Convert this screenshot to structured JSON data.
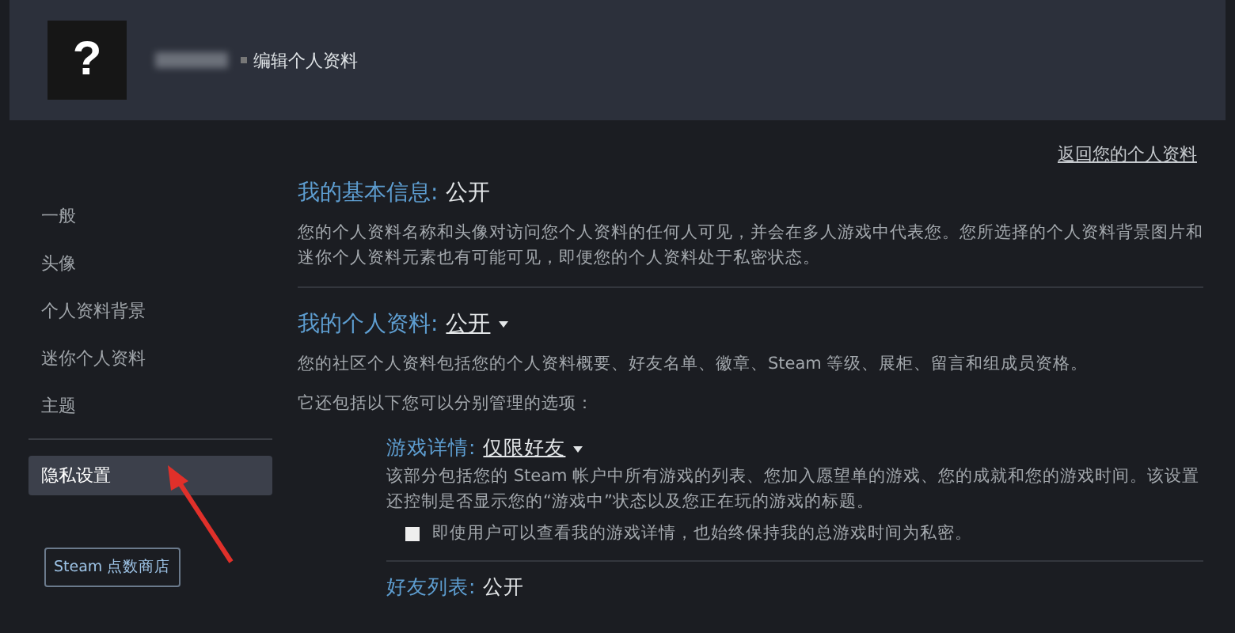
{
  "header": {
    "avatar_glyph": "?",
    "title": "编辑个人资料"
  },
  "sidebar": {
    "groups": [
      [
        {
          "label": "一般",
          "selected": false
        },
        {
          "label": "头像",
          "selected": false
        },
        {
          "label": "个人资料背景",
          "selected": false
        },
        {
          "label": "迷你个人资料",
          "selected": false
        },
        {
          "label": "主题",
          "selected": false
        }
      ],
      [
        {
          "label": "隐私设置",
          "selected": true
        }
      ]
    ],
    "store_button": "Steam 点数商店"
  },
  "back_link": "返回您的个人资料",
  "sections": [
    {
      "label": "我的基本信息:",
      "value": "公开",
      "dropdown": false,
      "paragraphs": [
        "您的个人资料名称和头像对访问您个人资料的任何人可见，并会在多人游戏中代表您。您所选择的个人资料背景图片和迷你个人资料元素也有可能可见，即便您的个人资料处于私密状态。"
      ]
    },
    {
      "label": "我的个人资料:",
      "value": "公开",
      "dropdown": true,
      "paragraphs": [
        "您的社区个人资料包括您的个人资料概要、好友名单、徽章、Steam 等级、展柜、留言和组成员资格。",
        "它还包括以下您可以分别管理的选项："
      ],
      "subsections": [
        {
          "label": "游戏详情:",
          "value": "仅限好友",
          "dropdown": true,
          "description": "该部分包括您的 Steam 帐户中所有游戏的列表、您加入愿望单的游戏、您的成就和您的游戏时间。该设置还控制是否显示您的“游戏中”状态以及您正在玩的游戏的标题。",
          "checkbox": {
            "label": "即使用户可以查看我的游戏详情，也始终保持我的总游戏时间为私密。",
            "checked": false
          }
        },
        {
          "label": "好友列表:",
          "value": "公开",
          "dropdown": false
        }
      ]
    }
  ]
}
